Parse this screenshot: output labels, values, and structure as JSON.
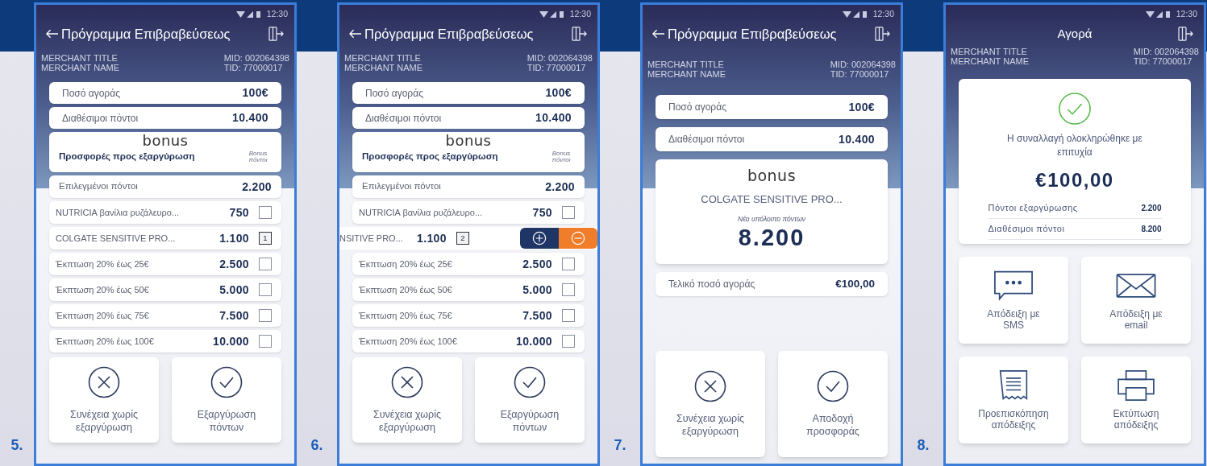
{
  "screens": [
    {
      "kind": "offers",
      "step": "5.",
      "time": "12:30",
      "title": "Πρόγραμμα Επιβραβεύσεως",
      "back_arrow": true,
      "merchant": {
        "title": "MERCHANT TITLE",
        "name": "MERCHANT NAME",
        "mid": "MID: 002064398",
        "tid": "TID: 77000017"
      },
      "summary": [
        {
          "label": "Ποσό αγοράς",
          "value": "100€"
        },
        {
          "label": "Διαθέσιμοι πόντοι",
          "value": "10.400"
        }
      ],
      "logo": "bonus",
      "heading": "Προσφορές προς εξαργύρωση",
      "column_label": "Bonus πόντοι",
      "selected_points": {
        "label": "Επιλεγμένοι πόντοι",
        "value": "2.200"
      },
      "offers": [
        {
          "kind": "row",
          "name": "NUTRICIA βανίλια ρυζάλευρο...",
          "points": "750",
          "checked": false
        },
        {
          "kind": "row",
          "name": "COLGATE SENSITIVE PRO...",
          "points": "1.100",
          "quantity": "1",
          "checked": true
        },
        {
          "kind": "row",
          "name": "Έκπτωση 20% έως 25€",
          "points": "2.500",
          "checked": false
        },
        {
          "kind": "row",
          "name": "Έκπτωση 20% έως 50€",
          "points": "5.000",
          "checked": false
        },
        {
          "kind": "row",
          "name": "Έκπτωση 20% έως 75€",
          "points": "7.500",
          "checked": false
        },
        {
          "kind": "row",
          "name": "Έκπτωση 20% έως 100€",
          "points": "10.000",
          "checked": false
        }
      ],
      "actions": [
        {
          "kind": "cross",
          "label": "Συνέχεια χωρίς εξαργύρωση"
        },
        {
          "kind": "check",
          "label": "Εξαργύρωση πόντων"
        }
      ]
    },
    {
      "kind": "offers",
      "step": "6.",
      "time": "12:30",
      "title": "Πρόγραμμα Επιβραβεύσεως",
      "back_arrow": true,
      "merchant": {
        "title": "MERCHANT TITLE",
        "name": "MERCHANT NAME",
        "mid": "MID: 002064398",
        "tid": "TID: 77000017"
      },
      "summary": [
        {
          "label": "Ποσό αγοράς",
          "value": "100€"
        },
        {
          "label": "Διαθέσιμοι πόντοι",
          "value": "10.400"
        }
      ],
      "logo": "bonus",
      "heading": "Προσφορές προς εξαργύρωση",
      "column_label": "Bonus πόντοι",
      "selected_points": {
        "label": "Επιλεγμένοι πόντοι",
        "value": "2.200"
      },
      "offers": [
        {
          "kind": "row",
          "name": "NUTRICIA βανίλια ρυζάλευρο...",
          "points": "750",
          "checked": false
        },
        {
          "kind": "swiped",
          "name": "NSITIVE PRO...",
          "points": "1.100",
          "quantity": "2",
          "checked": true
        },
        {
          "kind": "row",
          "name": "Έκπτωση 20% έως 25€",
          "points": "2.500",
          "checked": false
        },
        {
          "kind": "row",
          "name": "Έκπτωση 20% έως 50€",
          "points": "5.000",
          "checked": false
        },
        {
          "kind": "row",
          "name": "Έκπτωση 20% έως 75€",
          "points": "7.500",
          "checked": false
        },
        {
          "kind": "row",
          "name": "Έκπτωση 20% έως 100€",
          "points": "10.000",
          "checked": false
        }
      ],
      "actions": [
        {
          "kind": "cross",
          "label": "Συνέχεια χωρίς εξαργύρωση"
        },
        {
          "kind": "check",
          "label": "Εξαργύρωση πόντων"
        }
      ]
    },
    {
      "kind": "confirm",
      "step": "7.",
      "time": "12:30",
      "title": "Πρόγραμμα Επιβραβεύσεως",
      "back_arrow": true,
      "merchant": {
        "title": "MERCHANT TITLE",
        "name": "MERCHANT NAME",
        "mid": "MID: 002064398",
        "tid": "TID: 77000017"
      },
      "summary": [
        {
          "label": "Ποσό αγοράς",
          "value": "100€"
        },
        {
          "label": "Διαθέσιμοι πόντοι",
          "value": "10.400"
        }
      ],
      "logo": "bonus",
      "product": "COLGATE SENSITIVE PRO...",
      "caption": "Νέο υπόλοιπο πόντων",
      "balance": "8.200",
      "final": {
        "label": "Τελικό ποσό αγοράς",
        "value": "€100,00"
      },
      "actions": [
        {
          "kind": "cross",
          "label": "Συνέχεια χωρίς εξαργύρωση"
        },
        {
          "kind": "check",
          "label": "Αποδοχή προσφοράς"
        }
      ]
    },
    {
      "kind": "receipt",
      "step": "8.",
      "time": "12:30",
      "title": "Αγορά",
      "back_arrow": false,
      "merchant": {
        "title": "MERCHANT TITLE",
        "name": "MERCHANT NAME",
        "mid": "MID: 002064398",
        "tid": "TID: 77000017"
      },
      "message": "Η συναλλαγή ολοκληρώθηκε με επιτυχία",
      "amount": "€100,00",
      "details": [
        {
          "label": "Πόντοι εξαργύρωσης",
          "value": "2.200"
        },
        {
          "label": "Διαθέσιμοι πόντοι",
          "value": "8.200"
        }
      ],
      "tiles": [
        {
          "kind": "sms",
          "label": "Απόδειξη με SMS"
        },
        {
          "kind": "email",
          "label": "Απόδειξη με email"
        },
        {
          "kind": "receipt",
          "label": "Προεπισκόπηση απόδειξης"
        },
        {
          "kind": "printer",
          "label": "Εκτύπωση απόδειξης"
        }
      ]
    }
  ]
}
